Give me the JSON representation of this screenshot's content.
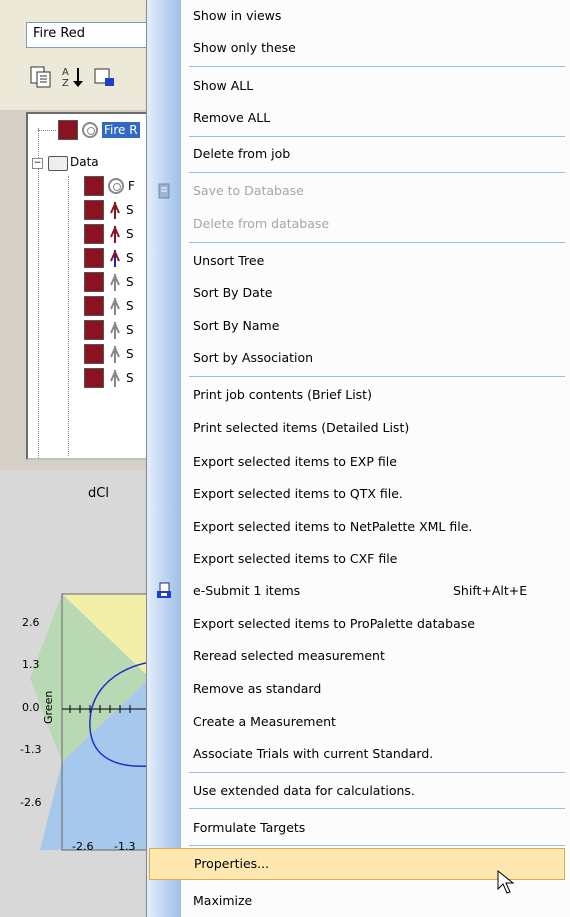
{
  "app": {
    "name_field_value": "Fire Red",
    "tree": {
      "root_label": "Fire R",
      "folder_label": "Data",
      "item_prefixes": [
        "F",
        "S",
        "S",
        "S",
        "S",
        "S",
        "S",
        "S",
        "S"
      ]
    },
    "plot": {
      "title": "dCl",
      "ylabel": "Green",
      "y_ticks": [
        "2.6",
        "1.3",
        "0.0",
        "-1.3",
        "-2.6"
      ],
      "x_ticks": [
        "-2.6",
        "-1.3"
      ]
    }
  },
  "menu": {
    "items": [
      {
        "label": "Show in views",
        "enabled": true
      },
      {
        "label": "Show only these",
        "enabled": true
      },
      {
        "label": "Show ALL",
        "enabled": true
      },
      {
        "label": "Remove ALL",
        "enabled": true
      },
      {
        "label": "Delete from job",
        "enabled": true
      },
      {
        "label": "Save to Database",
        "enabled": false,
        "icon": "database-icon"
      },
      {
        "label": "Delete from database",
        "enabled": false
      },
      {
        "label": "Unsort Tree",
        "enabled": true
      },
      {
        "label": "Sort By Date",
        "enabled": true
      },
      {
        "label": "Sort By Name",
        "enabled": true
      },
      {
        "label": "Sort by Association",
        "enabled": true
      },
      {
        "label": "Print job contents (Brief List)",
        "enabled": true
      },
      {
        "label": "Print selected items (Detailed List)",
        "enabled": true
      },
      {
        "label": "Export selected items to EXP file",
        "enabled": true
      },
      {
        "label": "Export selected items to QTX file.",
        "enabled": true
      },
      {
        "label": "Export selected items to NetPalette XML file.",
        "enabled": true
      },
      {
        "label": "Export selected items to CXF file",
        "enabled": true
      },
      {
        "label": "e-Submit 1 items",
        "enabled": true,
        "shortcut": "Shift+Alt+E",
        "icon": "e-submit-icon"
      },
      {
        "label": "Export selected items to ProPalette database",
        "enabled": true
      },
      {
        "label": "Reread selected measurement",
        "enabled": true
      },
      {
        "label": "Remove as standard",
        "enabled": true
      },
      {
        "label": "Create a Measurement",
        "enabled": true
      },
      {
        "label": "Associate Trials with current Standard.",
        "enabled": true
      },
      {
        "label": "Use extended data for calculations.",
        "enabled": true
      },
      {
        "label": "Formulate Targets",
        "enabled": true
      },
      {
        "label": "Properties...",
        "enabled": true,
        "hovered": true
      },
      {
        "label": "Maximize",
        "enabled": true
      }
    ]
  },
  "colors": {
    "accent_selection": "#316ac5",
    "swatch": "#8b1220",
    "hover_fill": "#ffe8b0",
    "separator": "#9dbbe3"
  }
}
